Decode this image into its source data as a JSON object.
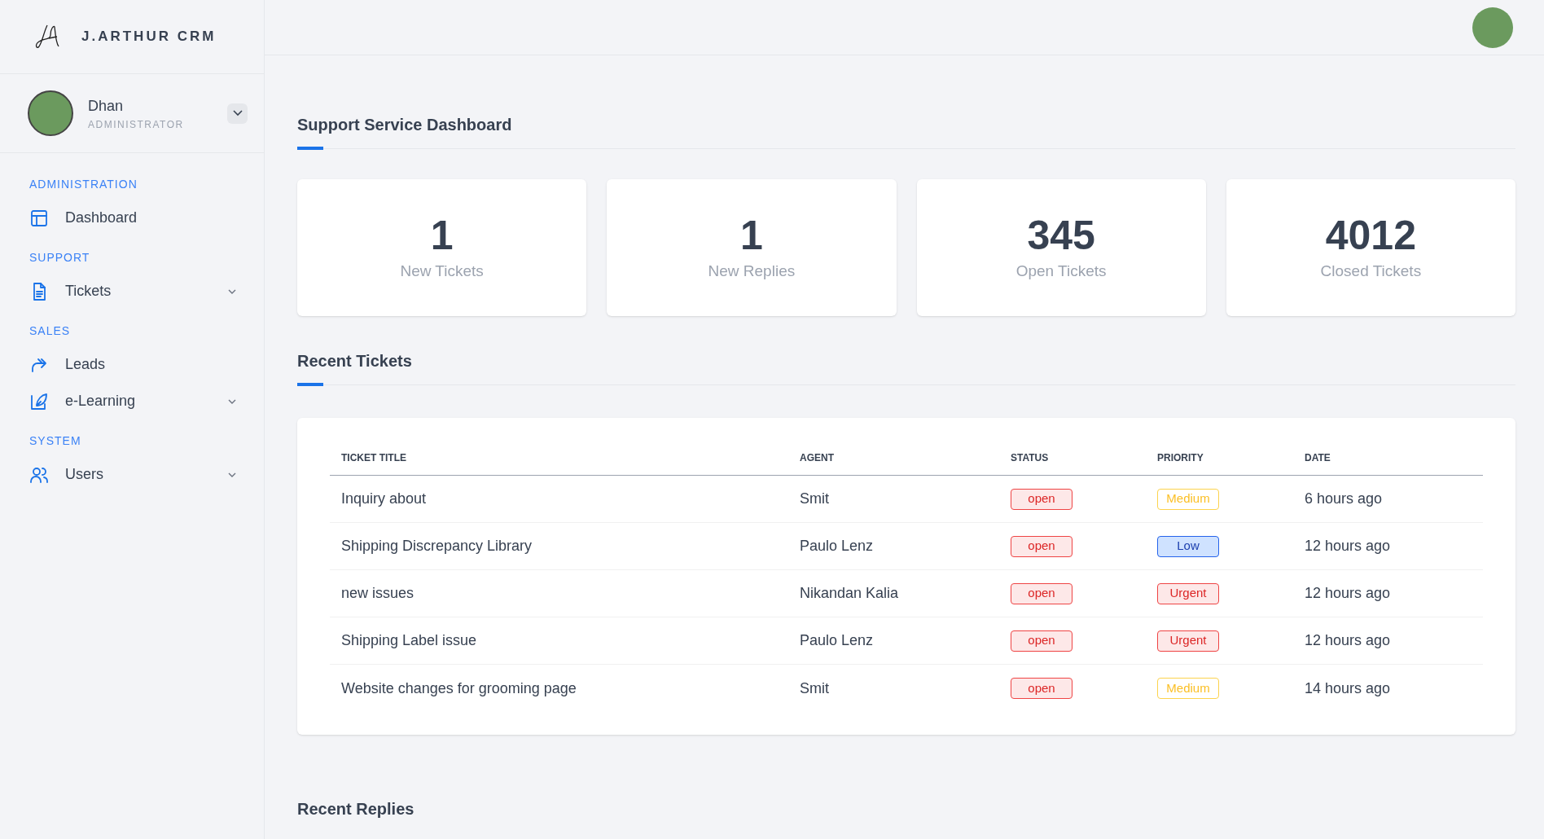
{
  "brand": {
    "name": "J.ARTHUR CRM"
  },
  "user": {
    "name": "Dhan",
    "role": "ADMINISTRATOR"
  },
  "sidebar": {
    "sections": [
      {
        "title": "ADMINISTRATION",
        "items": [
          {
            "label": "Dashboard",
            "kind": "layout",
            "expandable": false
          }
        ]
      },
      {
        "title": "SUPPORT",
        "items": [
          {
            "label": "Tickets",
            "kind": "document",
            "expandable": true
          }
        ]
      },
      {
        "title": "SALES",
        "items": [
          {
            "label": "Leads",
            "kind": "forward",
            "expandable": false
          },
          {
            "label": "e-Learning",
            "kind": "pen",
            "expandable": true
          }
        ]
      },
      {
        "title": "SYSTEM",
        "items": [
          {
            "label": "Users",
            "kind": "users",
            "expandable": true
          }
        ]
      }
    ]
  },
  "page_title": "Support Service Dashboard",
  "stats": [
    {
      "value": "1",
      "label": "New Tickets"
    },
    {
      "value": "1",
      "label": "New Replies"
    },
    {
      "value": "345",
      "label": "Open Tickets"
    },
    {
      "value": "4012",
      "label": "Closed Tickets"
    }
  ],
  "recent_tickets": {
    "title": "Recent Tickets",
    "columns": [
      "TICKET TITLE",
      "AGENT",
      "STATUS",
      "PRIORITY",
      "DATE"
    ],
    "rows": [
      {
        "title": "Inquiry about",
        "agent": "Smit",
        "status": {
          "text": "open",
          "kind": "open"
        },
        "priority": {
          "text": "Medium",
          "kind": "medium"
        },
        "date": "6 hours ago"
      },
      {
        "title": "Shipping Discrepancy Library",
        "agent": "Paulo Lenz",
        "status": {
          "text": "open",
          "kind": "open"
        },
        "priority": {
          "text": "Low",
          "kind": "low"
        },
        "date": "12 hours ago"
      },
      {
        "title": "new issues",
        "agent": "Nikandan Kalia",
        "status": {
          "text": "open",
          "kind": "open"
        },
        "priority": {
          "text": "Urgent",
          "kind": "urgent"
        },
        "date": "12 hours ago"
      },
      {
        "title": "Shipping Label issue",
        "agent": "Paulo Lenz",
        "status": {
          "text": "open",
          "kind": "open"
        },
        "priority": {
          "text": "Urgent",
          "kind": "urgent"
        },
        "date": "12 hours ago"
      },
      {
        "title": "Website changes for grooming page",
        "agent": "Smit",
        "status": {
          "text": "open",
          "kind": "open"
        },
        "priority": {
          "text": "Medium",
          "kind": "medium"
        },
        "date": "14 hours ago"
      }
    ]
  },
  "recent_replies": {
    "title": "Recent Replies"
  }
}
